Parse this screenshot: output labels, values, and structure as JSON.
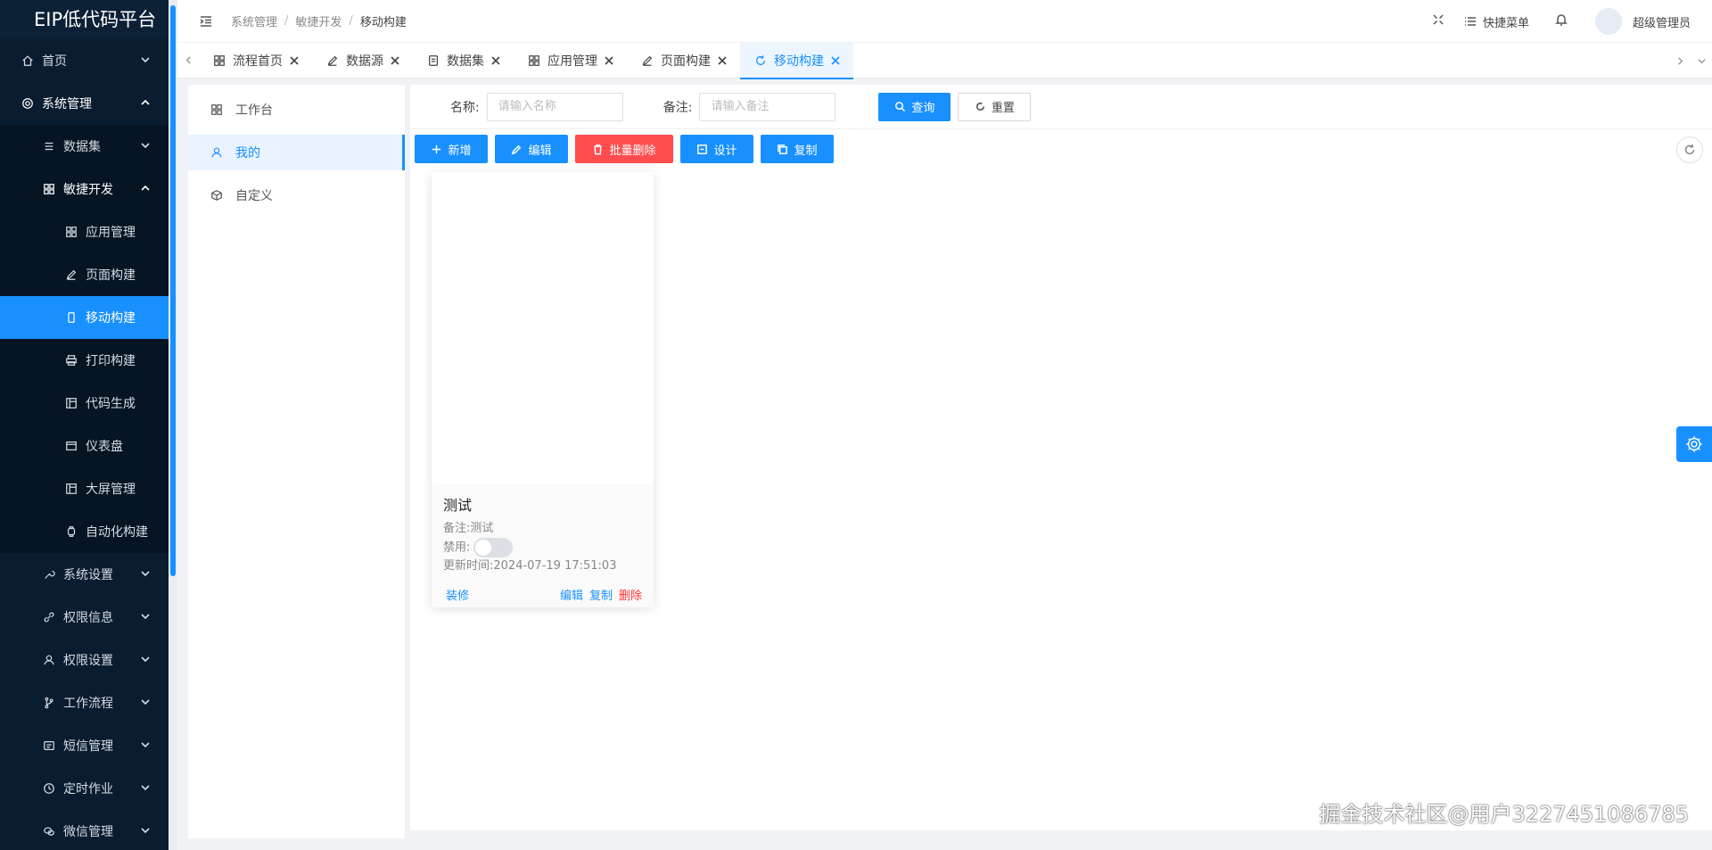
{
  "app": {
    "title": "EIP低代码平台"
  },
  "sidebar": {
    "items": [
      {
        "label": "首页",
        "icon": "home-icon"
      },
      {
        "label": "系统管理",
        "icon": "gear-icon"
      },
      {
        "label": "数据集",
        "icon": "list-icon"
      },
      {
        "label": "敏捷开发",
        "icon": "grid-icon"
      },
      {
        "label": "应用管理",
        "icon": "grid-icon"
      },
      {
        "label": "页面构建",
        "icon": "edit-icon"
      },
      {
        "label": "移动构建",
        "icon": "mobile-icon"
      },
      {
        "label": "打印构建",
        "icon": "printer-icon"
      },
      {
        "label": "代码生成",
        "icon": "layout-icon"
      },
      {
        "label": "仪表盘",
        "icon": "card-icon"
      },
      {
        "label": "大屏管理",
        "icon": "layout-icon"
      },
      {
        "label": "自动化构建",
        "icon": "watch-icon"
      },
      {
        "label": "系统设置",
        "icon": "tool-icon"
      },
      {
        "label": "权限信息",
        "icon": "link-icon"
      },
      {
        "label": "权限设置",
        "icon": "user-icon"
      },
      {
        "label": "工作流程",
        "icon": "branch-icon"
      },
      {
        "label": "短信管理",
        "icon": "sms-icon"
      },
      {
        "label": "定时作业",
        "icon": "clock-icon"
      },
      {
        "label": "微信管理",
        "icon": "wechat-icon"
      }
    ]
  },
  "header": {
    "breadcrumb": [
      "系统管理",
      "敏捷开发",
      "移动构建"
    ],
    "quick_menu": "快捷菜单",
    "user": "超级管理员"
  },
  "tabs": [
    {
      "label": "流程首页",
      "icon": "grid-icon"
    },
    {
      "label": "数据源",
      "icon": "edit-icon"
    },
    {
      "label": "数据集",
      "icon": "doc-icon"
    },
    {
      "label": "应用管理",
      "icon": "grid-icon"
    },
    {
      "label": "页面构建",
      "icon": "edit-icon"
    },
    {
      "label": "移动构建",
      "icon": "refresh-icon",
      "active": true
    }
  ],
  "categories": [
    {
      "label": "工作台",
      "icon": "grid-icon"
    },
    {
      "label": "我的",
      "icon": "user-icon",
      "active": true
    },
    {
      "label": "自定义",
      "icon": "cube-icon"
    }
  ],
  "search": {
    "name_label": "名称:",
    "name_placeholder": "请输入名称",
    "remark_label": "备注:",
    "remark_placeholder": "请输入备注",
    "query_label": "查询",
    "reset_label": "重置"
  },
  "toolbar": {
    "add": "新增",
    "edit": "编辑",
    "batch_delete": "批量删除",
    "design": "设计",
    "copy": "复制"
  },
  "cards": [
    {
      "title": "测试",
      "remark_label": "备注:",
      "remark": "测试",
      "disabled_label": "禁用:",
      "disabled": false,
      "updated_label": "更新时间:",
      "updated": "2024-07-19 17:51:03",
      "decorate": "装修",
      "edit": "编辑",
      "copy": "复制",
      "delete": "删除"
    }
  ],
  "watermark": "掘金技术社区@用户3227451086785",
  "colors": {
    "primary": "#1890ff",
    "danger": "#ff4d4f",
    "sidebar_bg": "#0a1c2f"
  }
}
